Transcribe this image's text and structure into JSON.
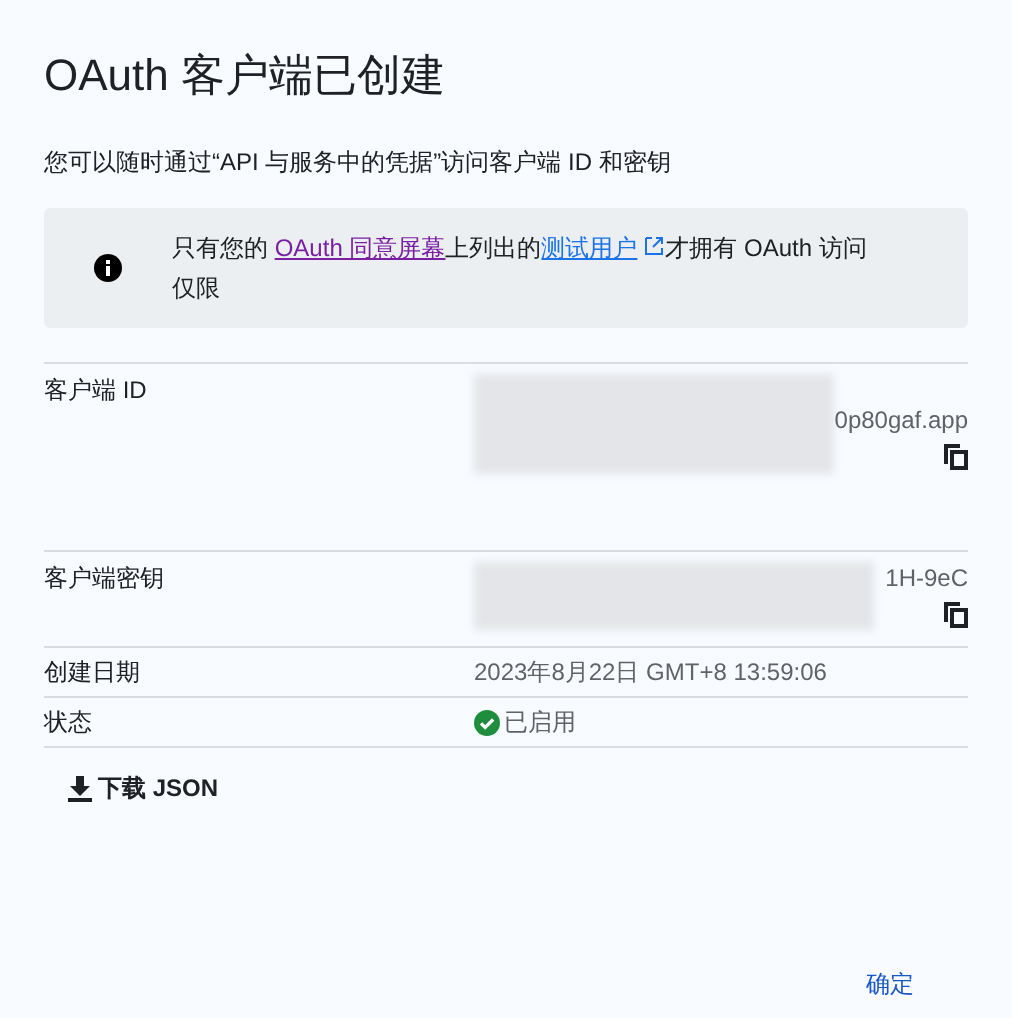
{
  "title": "OAuth 客户端已创建",
  "description": "您可以随时通过“API 与服务中的凭据”访问客户端 ID 和密钥",
  "notice": {
    "text_before": "只有您的 ",
    "link_1": "OAuth 同意屏幕",
    "text_middle": "上列出的",
    "link_2": "测试用户",
    "text_after": "才拥有 OAuth 访问仅限"
  },
  "fields": [
    {
      "kind": "secret",
      "label": "客户端 ID",
      "value": "0p80gaf.app",
      "copyable": true
    },
    {
      "kind": "secret",
      "label": "客户端密钥",
      "value": "1H-9eC",
      "copyable": true
    },
    {
      "kind": "text",
      "label": "创建日期",
      "value": "2023年8月22日 GMT+8 13:59:06"
    },
    {
      "kind": "status",
      "label": "状态",
      "value": "已启用",
      "enabled": true
    }
  ],
  "download_button": "下载 JSON",
  "confirm_button": "确定"
}
